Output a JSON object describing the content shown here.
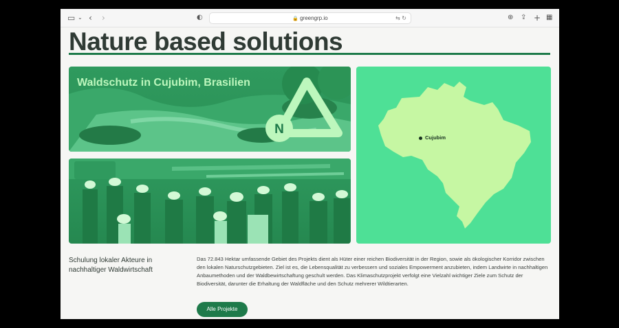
{
  "browser": {
    "url": "greengrp.io"
  },
  "page": {
    "headline": "Nature based solutions",
    "card1_title": "Waldschutz in Cujubim, Brasilien",
    "logo_letter": "N",
    "map_label": "Cujubim",
    "subtitle": "Schulung lokaler Akteure in nachhaltiger Waldwirtschaft",
    "body": "Das 72.843 Hektar umfassende Gebiet des Projekts dient als Hüter einer reichen Biodiversität in der Region, sowie als ökologischer Korridor zwischen den lokalen Naturschutzgebieten. Ziel ist es, die Lebensqualität zu verbessern und soziales Empowerment anzubieten, indem Landwirte in nachhaltigen Anbaumethoden und der Waldbewirtschaftung geschult werden. Das Klimaschutzprojekt verfolgt eine Vielzahl wichtiger Ziele zum Schutz der Biodiversität, darunter die Erhaltung der Waldfläche und den Schutz mehrerer Wildtierarten.",
    "button": "Alle Projekte"
  },
  "colors": {
    "brand_green": "#1e7a4a",
    "map_bg": "#4ee096",
    "map_land": "#c6f7a3",
    "photo_tint": "#2f9a5e"
  }
}
